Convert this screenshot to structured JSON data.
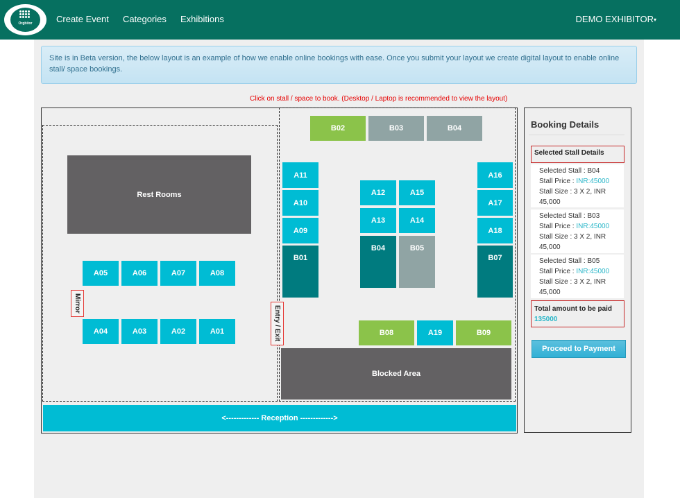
{
  "nav": {
    "logo_text": "Orgbitor",
    "links": [
      "Create Event",
      "Categories",
      "Exhibitions"
    ],
    "user": "DEMO EXHIBITOR"
  },
  "alert": {
    "text": "Site is in Beta version, the below layout is an example of how we enable online bookings with ease. Once you submit your layout we create digital layout to enable online stall/ space bookings."
  },
  "hint": "Click on stall / space to book. (Desktop / Laptop is recommended to view the layout)",
  "layout": {
    "rest_rooms": "Rest Rooms",
    "blocked_area": "Blocked Area",
    "mirror": "Mirror",
    "entry_exit": "Entry / Exit",
    "reception": "<------------- Reception ------------->",
    "stalls": {
      "B02": "B02",
      "B03": "B03",
      "B04": "B04",
      "A11": "A11",
      "A10": "A10",
      "A09": "A09",
      "B01": "B01",
      "A12": "A12",
      "A15": "A15",
      "A13": "A13",
      "A14": "A14",
      "B04b": "B04",
      "B05": "B05",
      "A16": "A16",
      "A17": "A17",
      "A18": "A18",
      "B07": "B07",
      "A05": "A05",
      "A06": "A06",
      "A07": "A07",
      "A08": "A08",
      "A04": "A04",
      "A03": "A03",
      "A02": "A02",
      "A01": "A01",
      "B08": "B08",
      "A19": "A19",
      "B09": "B09"
    },
    "colors": {
      "available": "#00bcd4",
      "selected": "#8bc34a",
      "booked": "#90a4a4",
      "premium": "#007b7f",
      "blocked": "#636163"
    }
  },
  "booking": {
    "title": "Booking Details",
    "selected_header": "Selected Stall Details",
    "items": [
      {
        "stall": "Selected Stall : B04",
        "price_label": "Stall Price : ",
        "price": "INR:45000",
        "size": "Stall Size : 3 X 2, INR 45,000"
      },
      {
        "stall": "Selected Stall : B03",
        "price_label": "Stall Price : ",
        "price": "INR:45000",
        "size": "Stall Size : 3 X 2, INR 45,000"
      },
      {
        "stall": "Selected Stall : B05",
        "price_label": "Stall Price : ",
        "price": "INR:45000",
        "size": "Stall Size : 3 X 2, INR 45,000"
      }
    ],
    "total_label": "Total amount to be paid",
    "total_value": "135000",
    "pay_button": "Proceed to Payment"
  }
}
